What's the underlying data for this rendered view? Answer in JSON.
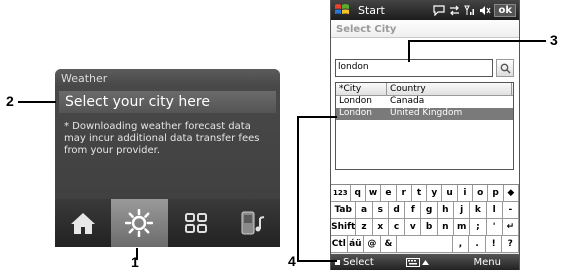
{
  "callouts": {
    "c1": "1",
    "c2": "2",
    "c3": "3",
    "c4": "4"
  },
  "weather_panel": {
    "header": "Weather",
    "title": "Select your city here",
    "note": "* Downloading weather forecast data may incur additional data transfer fees from your provider.",
    "tabs": [
      {
        "icon": "home-icon"
      },
      {
        "icon": "weather-sun-icon"
      },
      {
        "icon": "grid-icon"
      },
      {
        "icon": "phone-music-icon"
      }
    ]
  },
  "phone": {
    "status": {
      "start_label": "Start",
      "ok_label": "ok"
    },
    "screen_title": "Select City",
    "search": {
      "value": "london"
    },
    "list": {
      "headers": [
        "*City",
        "Country"
      ],
      "rows": [
        {
          "city": "London",
          "country": "Canada"
        },
        {
          "city": "London",
          "country": "United Kingdom"
        }
      ]
    },
    "keyboard": {
      "rows": [
        [
          "123",
          "q",
          "w",
          "e",
          "r",
          "t",
          "y",
          "u",
          "i",
          "o",
          "p",
          "◆"
        ],
        [
          "Tab",
          "a",
          "s",
          "d",
          "f",
          "g",
          "h",
          "j",
          "k",
          "l",
          "-"
        ],
        [
          "Shift",
          "z",
          "x",
          "c",
          "v",
          "b",
          "n",
          "m",
          ";",
          "'",
          "↵"
        ],
        [
          "Ctl",
          "áü",
          "@",
          "&",
          "",
          ",",
          ".",
          "!",
          "?"
        ]
      ]
    },
    "softkeys": {
      "left": "Select",
      "right": "Menu"
    }
  },
  "colors": {
    "panel_bg": "#3d3d3d",
    "active_tab": "#8a8a8a",
    "selected_row": "#7a7a7a"
  }
}
